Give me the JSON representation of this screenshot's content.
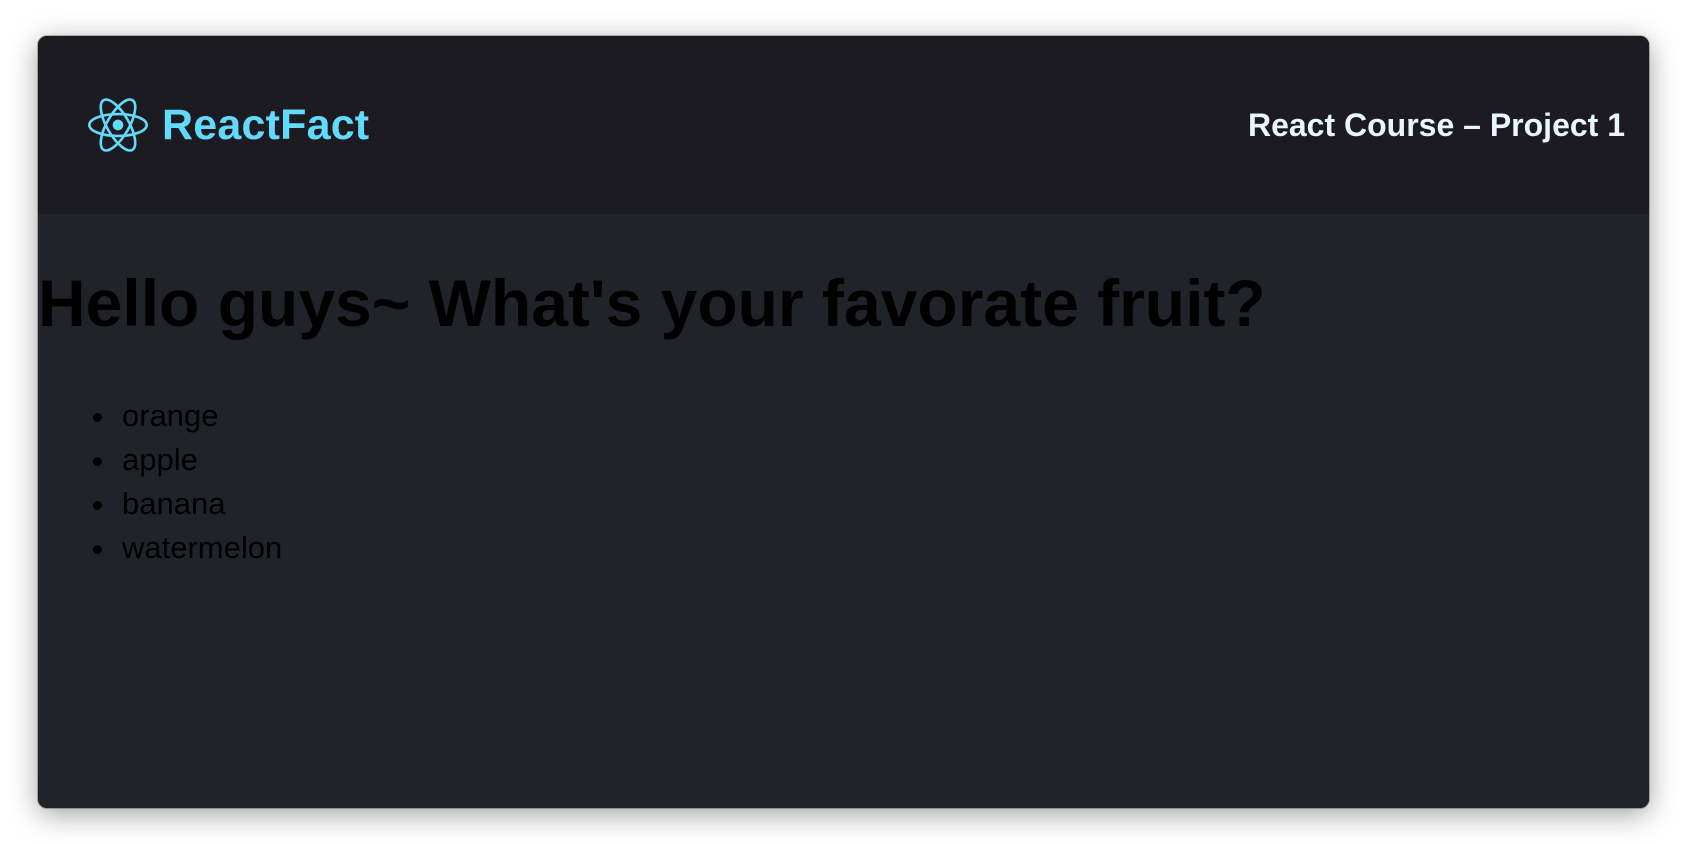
{
  "header": {
    "brand": "ReactFact",
    "subtitle": "React Course – Project 1"
  },
  "main": {
    "heading": "Hello guys~ What's your favorate fruit?",
    "fruits": [
      "orange",
      "apple",
      "banana",
      "watermelon"
    ]
  },
  "icons": {
    "logo": "react-atom-icon"
  },
  "colors": {
    "brand_accent": "#61dafb",
    "nav_background": "#1c1b21",
    "page_background": "#20232a",
    "nav_text": "#e9f6fd",
    "content_text": "#000000"
  }
}
